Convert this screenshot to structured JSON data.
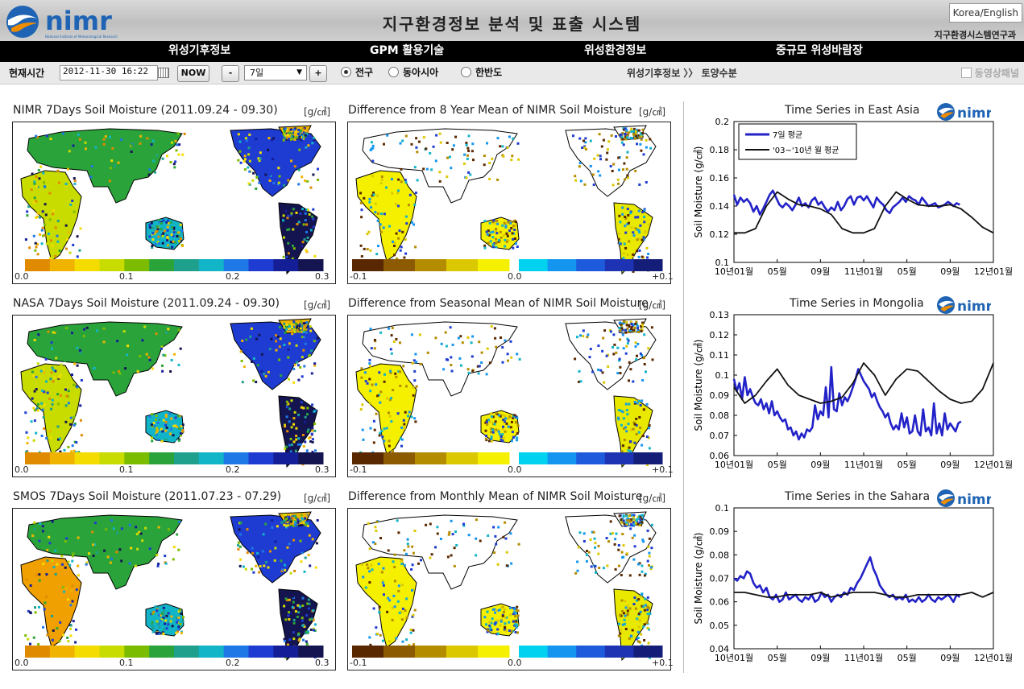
{
  "header": {
    "logo_text": "nimr",
    "logo_subtext": "National Institute of Meteorological Research",
    "title": "지구환경정보 분석 및 표출 시스템",
    "language_button": "Korea/English",
    "organization": "지구환경시스템연구과"
  },
  "nav": {
    "items": [
      "위성기후정보",
      "GPM 활용기술",
      "위성환경정보",
      "중규모 위성바람장"
    ]
  },
  "toolbar": {
    "time_label": "현재시간",
    "time_value": "2012-11-30 16:22",
    "now_button": "NOW",
    "minus_button": "-",
    "plus_button": "+",
    "month_value": "7일",
    "region_options": [
      {
        "label": "전구",
        "selected": true
      },
      {
        "label": "동아시아",
        "selected": false
      },
      {
        "label": "한반도",
        "selected": false
      }
    ],
    "breadcrumb": "위성기후정보  〉〉 토양수분",
    "panel_toggle": "동영상패널"
  },
  "maps": [
    {
      "title": "NIMR 7Days Soil Moisture (2011.09.24 - 09.30)",
      "unit": "[g/㎤]",
      "kind": "abs",
      "cb_labels": [
        "0.0",
        "0.1",
        "0.2",
        "0.3"
      ]
    },
    {
      "title": "Difference from 8 Year Mean of NIMR Soil Moisture",
      "unit": "[g/㎤]",
      "kind": "diff",
      "cb_labels": [
        "-0.1",
        "0.0",
        "+0.1"
      ]
    },
    {
      "title": "NASA 7Days Soil Moisture (2011.09.24 - 09.30)",
      "unit": "[g/㎤]",
      "kind": "abs",
      "cb_labels": [
        "0.0",
        "0.1",
        "0.2",
        "0.3"
      ]
    },
    {
      "title": "Difference from Seasonal Mean of NIMR Soil Moisture",
      "unit": "[g/㎤]",
      "kind": "diff",
      "cb_labels": [
        "-0.1",
        "0.0",
        "+0.1"
      ]
    },
    {
      "title": "SMOS 7Days Soil Moisture (2011.07.23 - 07.29)",
      "unit": "[g/㎤]",
      "kind": "abs",
      "cb_labels": [
        "0.0",
        "0.1",
        "0.2",
        "0.3"
      ]
    },
    {
      "title": "Difference from Monthly Mean of NIMR Soil Moisture",
      "unit": "[g/㎤]",
      "kind": "diff",
      "cb_labels": [
        "-0.1",
        "0.0",
        "+0.1"
      ]
    }
  ],
  "colors": {
    "nimr_logo_blue": "#1f64b4",
    "series_7day": "#2222c8",
    "series_mean": "#111111",
    "colorbar_abs": [
      "#e08a00",
      "#f0b400",
      "#f5dc00",
      "#c8dc00",
      "#7cbc00",
      "#2aa43a",
      "#1ea08c",
      "#12b4c8",
      "#1e78e6",
      "#1e3cd2",
      "#141e96",
      "#141450"
    ],
    "colorbar_diff_neg": [
      "#5a2800",
      "#8c5a00",
      "#b48c00",
      "#dcc800",
      "#f5f000"
    ],
    "colorbar_diff_pos": [
      "#00d2f0",
      "#1496f0",
      "#1e5adc",
      "#1e32b4",
      "#141e78"
    ]
  },
  "chart_data": [
    {
      "type": "line",
      "title": "Time Series in East Asia",
      "ylabel": "Soil Moisture (g/㎤)",
      "ylim": [
        0.1,
        0.2
      ],
      "yticks": [
        "0.2",
        "0.18",
        "0.16",
        "0.14",
        "0.12",
        "0.1"
      ],
      "x_ticks": [
        "10년01월",
        "05월",
        "09월",
        "11년01월",
        "05월",
        "09월",
        "12년01월"
      ],
      "x_range_months": [
        0,
        24
      ],
      "legend": {
        "placement": "top-left"
      },
      "series": [
        {
          "name": "7일 평균",
          "color": "#2222c8",
          "x": [
            0,
            0.3,
            0.6,
            0.9,
            1.2,
            1.5,
            1.8,
            2.1,
            2.4,
            2.7,
            3,
            3.3,
            3.6,
            3.9,
            4.2,
            4.5,
            4.8,
            5.1,
            5.4,
            5.7,
            6,
            6.3,
            6.6,
            6.9,
            7.2,
            7.5,
            7.8,
            8.1,
            8.4,
            8.7,
            9,
            9.3,
            9.6,
            9.9,
            10.2,
            10.5,
            10.8,
            11.1,
            11.4,
            11.7,
            12,
            12.3,
            12.6,
            12.9,
            13.2,
            13.5,
            13.8,
            14.1,
            14.4,
            14.7,
            15,
            15.3,
            15.6,
            15.9,
            16.2,
            16.5,
            16.8,
            17.1,
            17.4,
            17.7,
            18,
            18.3,
            18.6,
            18.9,
            19.2,
            19.5,
            19.8,
            20,
            20.3,
            20.6,
            20.9
          ],
          "values": [
            0.148,
            0.141,
            0.146,
            0.143,
            0.145,
            0.142,
            0.136,
            0.14,
            0.134,
            0.138,
            0.143,
            0.148,
            0.151,
            0.146,
            0.141,
            0.139,
            0.142,
            0.14,
            0.137,
            0.141,
            0.146,
            0.14,
            0.142,
            0.139,
            0.144,
            0.146,
            0.141,
            0.143,
            0.139,
            0.136,
            0.139,
            0.137,
            0.143,
            0.137,
            0.14,
            0.145,
            0.147,
            0.141,
            0.146,
            0.147,
            0.144,
            0.147,
            0.143,
            0.139,
            0.146,
            0.143,
            0.141,
            0.137,
            0.135,
            0.139,
            0.141,
            0.143,
            0.146,
            0.143,
            0.147,
            0.145,
            0.144,
            0.141,
            0.146,
            0.143,
            0.14,
            0.141,
            0.142,
            0.139,
            0.14,
            0.141,
            0.143,
            0.142,
            0.14,
            0.142,
            0.141
          ]
        },
        {
          "name": "'03~'10년 월 평균",
          "color": "#111111",
          "x": [
            0,
            1,
            2,
            3,
            4,
            5,
            6,
            7,
            8,
            9,
            10,
            11,
            12,
            13,
            14,
            15,
            16,
            17,
            18,
            19,
            20,
            21,
            22,
            23,
            24
          ],
          "values": [
            0.121,
            0.121,
            0.124,
            0.14,
            0.15,
            0.145,
            0.141,
            0.14,
            0.138,
            0.134,
            0.124,
            0.121,
            0.121,
            0.124,
            0.14,
            0.15,
            0.145,
            0.141,
            0.14,
            0.14,
            0.141,
            0.138,
            0.132,
            0.125,
            0.121
          ]
        }
      ]
    },
    {
      "type": "line",
      "title": "Time Series in Mongolia",
      "ylabel": "Soil Moisture (g/㎤)",
      "ylim": [
        0.06,
        0.13
      ],
      "yticks": [
        "0.13",
        "0.12",
        "0.11",
        "0.1",
        "0.09",
        "0.08",
        "0.07",
        "0.06"
      ],
      "x_ticks": [
        "10년01월",
        "05월",
        "09월",
        "11년01월",
        "05월",
        "09월",
        "12년01월"
      ],
      "x_range_months": [
        0,
        24
      ],
      "series": [
        {
          "name": "7일 평균",
          "color": "#2222c8",
          "x": [
            0,
            0.25,
            0.5,
            0.75,
            1,
            1.25,
            1.5,
            1.75,
            2,
            2.25,
            2.5,
            2.75,
            3,
            3.25,
            3.5,
            3.75,
            4,
            4.25,
            4.5,
            4.75,
            5,
            5.25,
            5.5,
            5.75,
            6,
            6.25,
            6.5,
            6.75,
            7,
            7.25,
            7.5,
            7.75,
            8,
            8.25,
            8.5,
            8.75,
            9,
            9.25,
            9.5,
            9.75,
            10,
            10.25,
            10.5,
            10.75,
            11,
            11.25,
            11.5,
            11.75,
            12,
            12.25,
            12.5,
            12.75,
            13,
            13.25,
            13.5,
            13.75,
            14,
            14.25,
            14.5,
            14.75,
            15,
            15.25,
            15.5,
            15.75,
            16,
            16.25,
            16.5,
            16.75,
            17,
            17.25,
            17.5,
            17.75,
            18,
            18.25,
            18.5,
            18.75,
            19,
            19.25,
            19.5,
            19.75,
            20,
            20.25,
            20.5,
            20.75,
            21
          ],
          "values": [
            0.098,
            0.092,
            0.096,
            0.088,
            0.099,
            0.09,
            0.093,
            0.089,
            0.086,
            0.085,
            0.088,
            0.083,
            0.086,
            0.081,
            0.087,
            0.08,
            0.082,
            0.079,
            0.077,
            0.078,
            0.073,
            0.074,
            0.07,
            0.072,
            0.068,
            0.071,
            0.069,
            0.073,
            0.072,
            0.074,
            0.085,
            0.078,
            0.082,
            0.08,
            0.094,
            0.079,
            0.104,
            0.083,
            0.082,
            0.091,
            0.085,
            0.089,
            0.087,
            0.09,
            0.094,
            0.098,
            0.103,
            0.1,
            0.097,
            0.095,
            0.093,
            0.089,
            0.091,
            0.087,
            0.084,
            0.082,
            0.079,
            0.081,
            0.076,
            0.073,
            0.075,
            0.073,
            0.081,
            0.074,
            0.079,
            0.071,
            0.072,
            0.08,
            0.072,
            0.07,
            0.083,
            0.072,
            0.074,
            0.07,
            0.086,
            0.071,
            0.076,
            0.07,
            0.081,
            0.073,
            0.076,
            0.074,
            0.072,
            0.076,
            0.077
          ]
        },
        {
          "name": "'03~'10년 월 평균",
          "color": "#111111",
          "x": [
            0,
            1,
            2,
            3,
            4,
            5,
            6,
            7,
            8,
            9,
            10,
            11,
            12,
            13,
            14,
            15,
            16,
            17,
            18,
            19,
            20,
            21,
            22,
            23,
            24
          ],
          "values": [
            0.094,
            0.086,
            0.09,
            0.097,
            0.103,
            0.095,
            0.09,
            0.088,
            0.086,
            0.087,
            0.089,
            0.096,
            0.106,
            0.1,
            0.09,
            0.098,
            0.103,
            0.102,
            0.097,
            0.092,
            0.088,
            0.086,
            0.087,
            0.093,
            0.106
          ]
        }
      ]
    },
    {
      "type": "line",
      "title": "Time Series in the Sahara",
      "ylabel": "Soil Moisture (g/㎤)",
      "ylim": [
        0.04,
        0.1
      ],
      "yticks": [
        "0.1",
        "0.09",
        "0.08",
        "0.07",
        "0.06",
        "0.05",
        "0.04"
      ],
      "x_ticks": [
        "10년01월",
        "05월",
        "09월",
        "11년01월",
        "05월",
        "09월",
        "12년01월"
      ],
      "x_range_months": [
        0,
        24
      ],
      "series": [
        {
          "name": "7일 평균",
          "color": "#2222c8",
          "x": [
            0,
            0.3,
            0.6,
            0.9,
            1.2,
            1.5,
            1.8,
            2.1,
            2.4,
            2.7,
            3,
            3.3,
            3.6,
            3.9,
            4.2,
            4.5,
            4.8,
            5.1,
            5.4,
            5.7,
            6,
            6.3,
            6.6,
            6.9,
            7.2,
            7.5,
            7.8,
            8.1,
            8.4,
            8.7,
            9,
            9.3,
            9.6,
            9.9,
            10.2,
            10.5,
            10.8,
            11.1,
            11.4,
            11.7,
            12,
            12.3,
            12.6,
            12.9,
            13.2,
            13.5,
            13.8,
            14.1,
            14.4,
            14.7,
            15,
            15.3,
            15.6,
            15.9,
            16.2,
            16.5,
            16.8,
            17.1,
            17.4,
            17.7,
            18,
            18.3,
            18.6,
            18.9,
            19.2,
            19.5,
            19.8,
            20,
            20.3,
            20.6,
            20.9
          ],
          "values": [
            0.07,
            0.069,
            0.071,
            0.07,
            0.073,
            0.072,
            0.068,
            0.066,
            0.067,
            0.064,
            0.066,
            0.062,
            0.061,
            0.063,
            0.06,
            0.061,
            0.064,
            0.061,
            0.062,
            0.063,
            0.061,
            0.06,
            0.062,
            0.061,
            0.063,
            0.06,
            0.061,
            0.064,
            0.062,
            0.063,
            0.06,
            0.062,
            0.063,
            0.062,
            0.064,
            0.063,
            0.066,
            0.065,
            0.068,
            0.07,
            0.073,
            0.076,
            0.079,
            0.074,
            0.071,
            0.067,
            0.065,
            0.063,
            0.062,
            0.063,
            0.061,
            0.062,
            0.061,
            0.063,
            0.06,
            0.061,
            0.06,
            0.062,
            0.06,
            0.061,
            0.063,
            0.061,
            0.06,
            0.062,
            0.061,
            0.062,
            0.063,
            0.062,
            0.06,
            0.063,
            0.062
          ]
        },
        {
          "name": "'03~'10년 월 평균",
          "color": "#111111",
          "x": [
            0,
            1,
            2,
            3,
            4,
            5,
            6,
            7,
            8,
            9,
            10,
            11,
            12,
            13,
            14,
            15,
            16,
            17,
            18,
            19,
            20,
            21,
            22,
            23,
            24
          ],
          "values": [
            0.064,
            0.064,
            0.063,
            0.062,
            0.062,
            0.063,
            0.063,
            0.063,
            0.064,
            0.062,
            0.063,
            0.064,
            0.064,
            0.064,
            0.063,
            0.062,
            0.062,
            0.063,
            0.063,
            0.063,
            0.063,
            0.063,
            0.064,
            0.062,
            0.064
          ]
        }
      ]
    }
  ]
}
